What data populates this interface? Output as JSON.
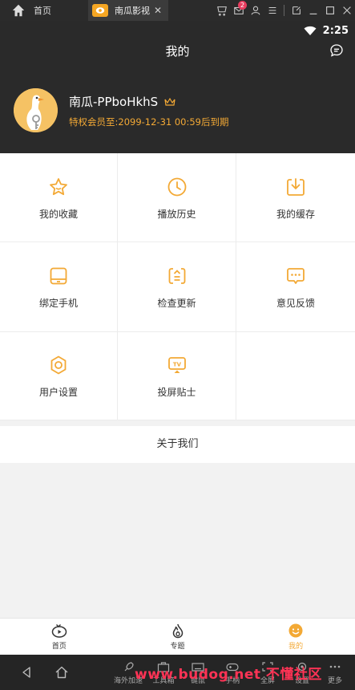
{
  "emulator": {
    "home_label": "首页",
    "tab_label": "南瓜影视",
    "tab_close": "✕",
    "notification_count": "2"
  },
  "status_bar": {
    "time": "2:25"
  },
  "header": {
    "title": "我的",
    "username": "南瓜-PPboHkhS",
    "vip_text": "特权会员至:2099-12-31 00:59后到期"
  },
  "grid": {
    "items": [
      {
        "label": "我的收藏",
        "icon": "star-icon"
      },
      {
        "label": "播放历史",
        "icon": "clock-icon"
      },
      {
        "label": "我的缓存",
        "icon": "download-icon"
      },
      {
        "label": "绑定手机",
        "icon": "phone-icon"
      },
      {
        "label": "检查更新",
        "icon": "update-icon"
      },
      {
        "label": "意见反馈",
        "icon": "feedback-icon"
      },
      {
        "label": "用户设置",
        "icon": "settings-icon"
      },
      {
        "label": "投屏贴士",
        "icon": "tv-cast-icon"
      }
    ]
  },
  "about": {
    "label": "关于我们"
  },
  "bottom_nav": {
    "items": [
      {
        "label": "首页",
        "icon": "home-tv-icon",
        "active": false
      },
      {
        "label": "专题",
        "icon": "topic-icon",
        "active": false
      },
      {
        "label": "我的",
        "icon": "profile-icon",
        "active": true
      }
    ]
  },
  "emulator_toolbar": {
    "items": [
      {
        "label": "海外加速"
      },
      {
        "label": "工具箱"
      },
      {
        "label": "键鼠"
      },
      {
        "label": "手柄"
      },
      {
        "label": "全屏"
      },
      {
        "label": "设置"
      },
      {
        "label": "更多"
      }
    ],
    "watermark": "www.budog.net 不懂社区"
  },
  "colors": {
    "accent": "#f3a935",
    "header_bg": "#2a2a2a",
    "badge": "#e83d5f"
  }
}
